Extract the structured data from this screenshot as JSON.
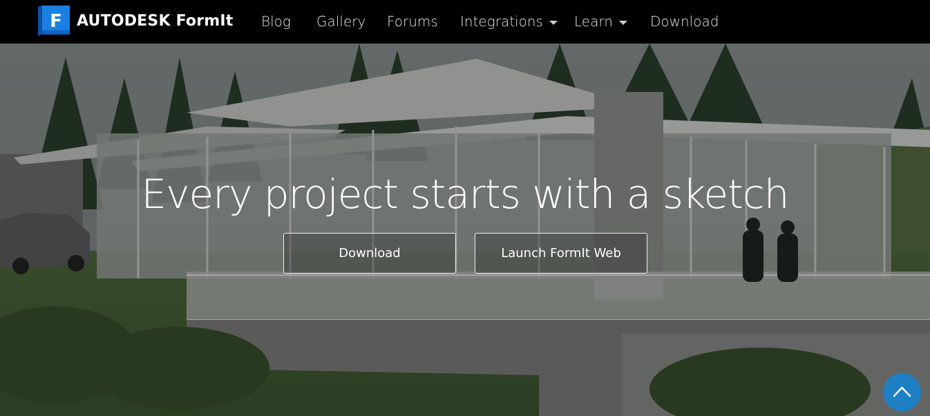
{
  "brand": {
    "logo_letter": "F",
    "name": "AUTODESK FormIt",
    "logo_color": "#1a7fe0"
  },
  "nav": {
    "items": [
      {
        "label": "Blog",
        "dropdown": false
      },
      {
        "label": "Gallery",
        "dropdown": false
      },
      {
        "label": "Forums",
        "dropdown": false
      },
      {
        "label": "Integrations",
        "dropdown": true
      },
      {
        "label": "Learn",
        "dropdown": true
      },
      {
        "label": "Download",
        "dropdown": false
      }
    ]
  },
  "hero": {
    "headline": "Every project starts with a sketch",
    "buttons": {
      "download": "Download",
      "launch_web": "Launch FormIt Web"
    }
  },
  "scroll_top": {
    "icon": "chevron-up-icon",
    "color": "#1f7fc4"
  }
}
